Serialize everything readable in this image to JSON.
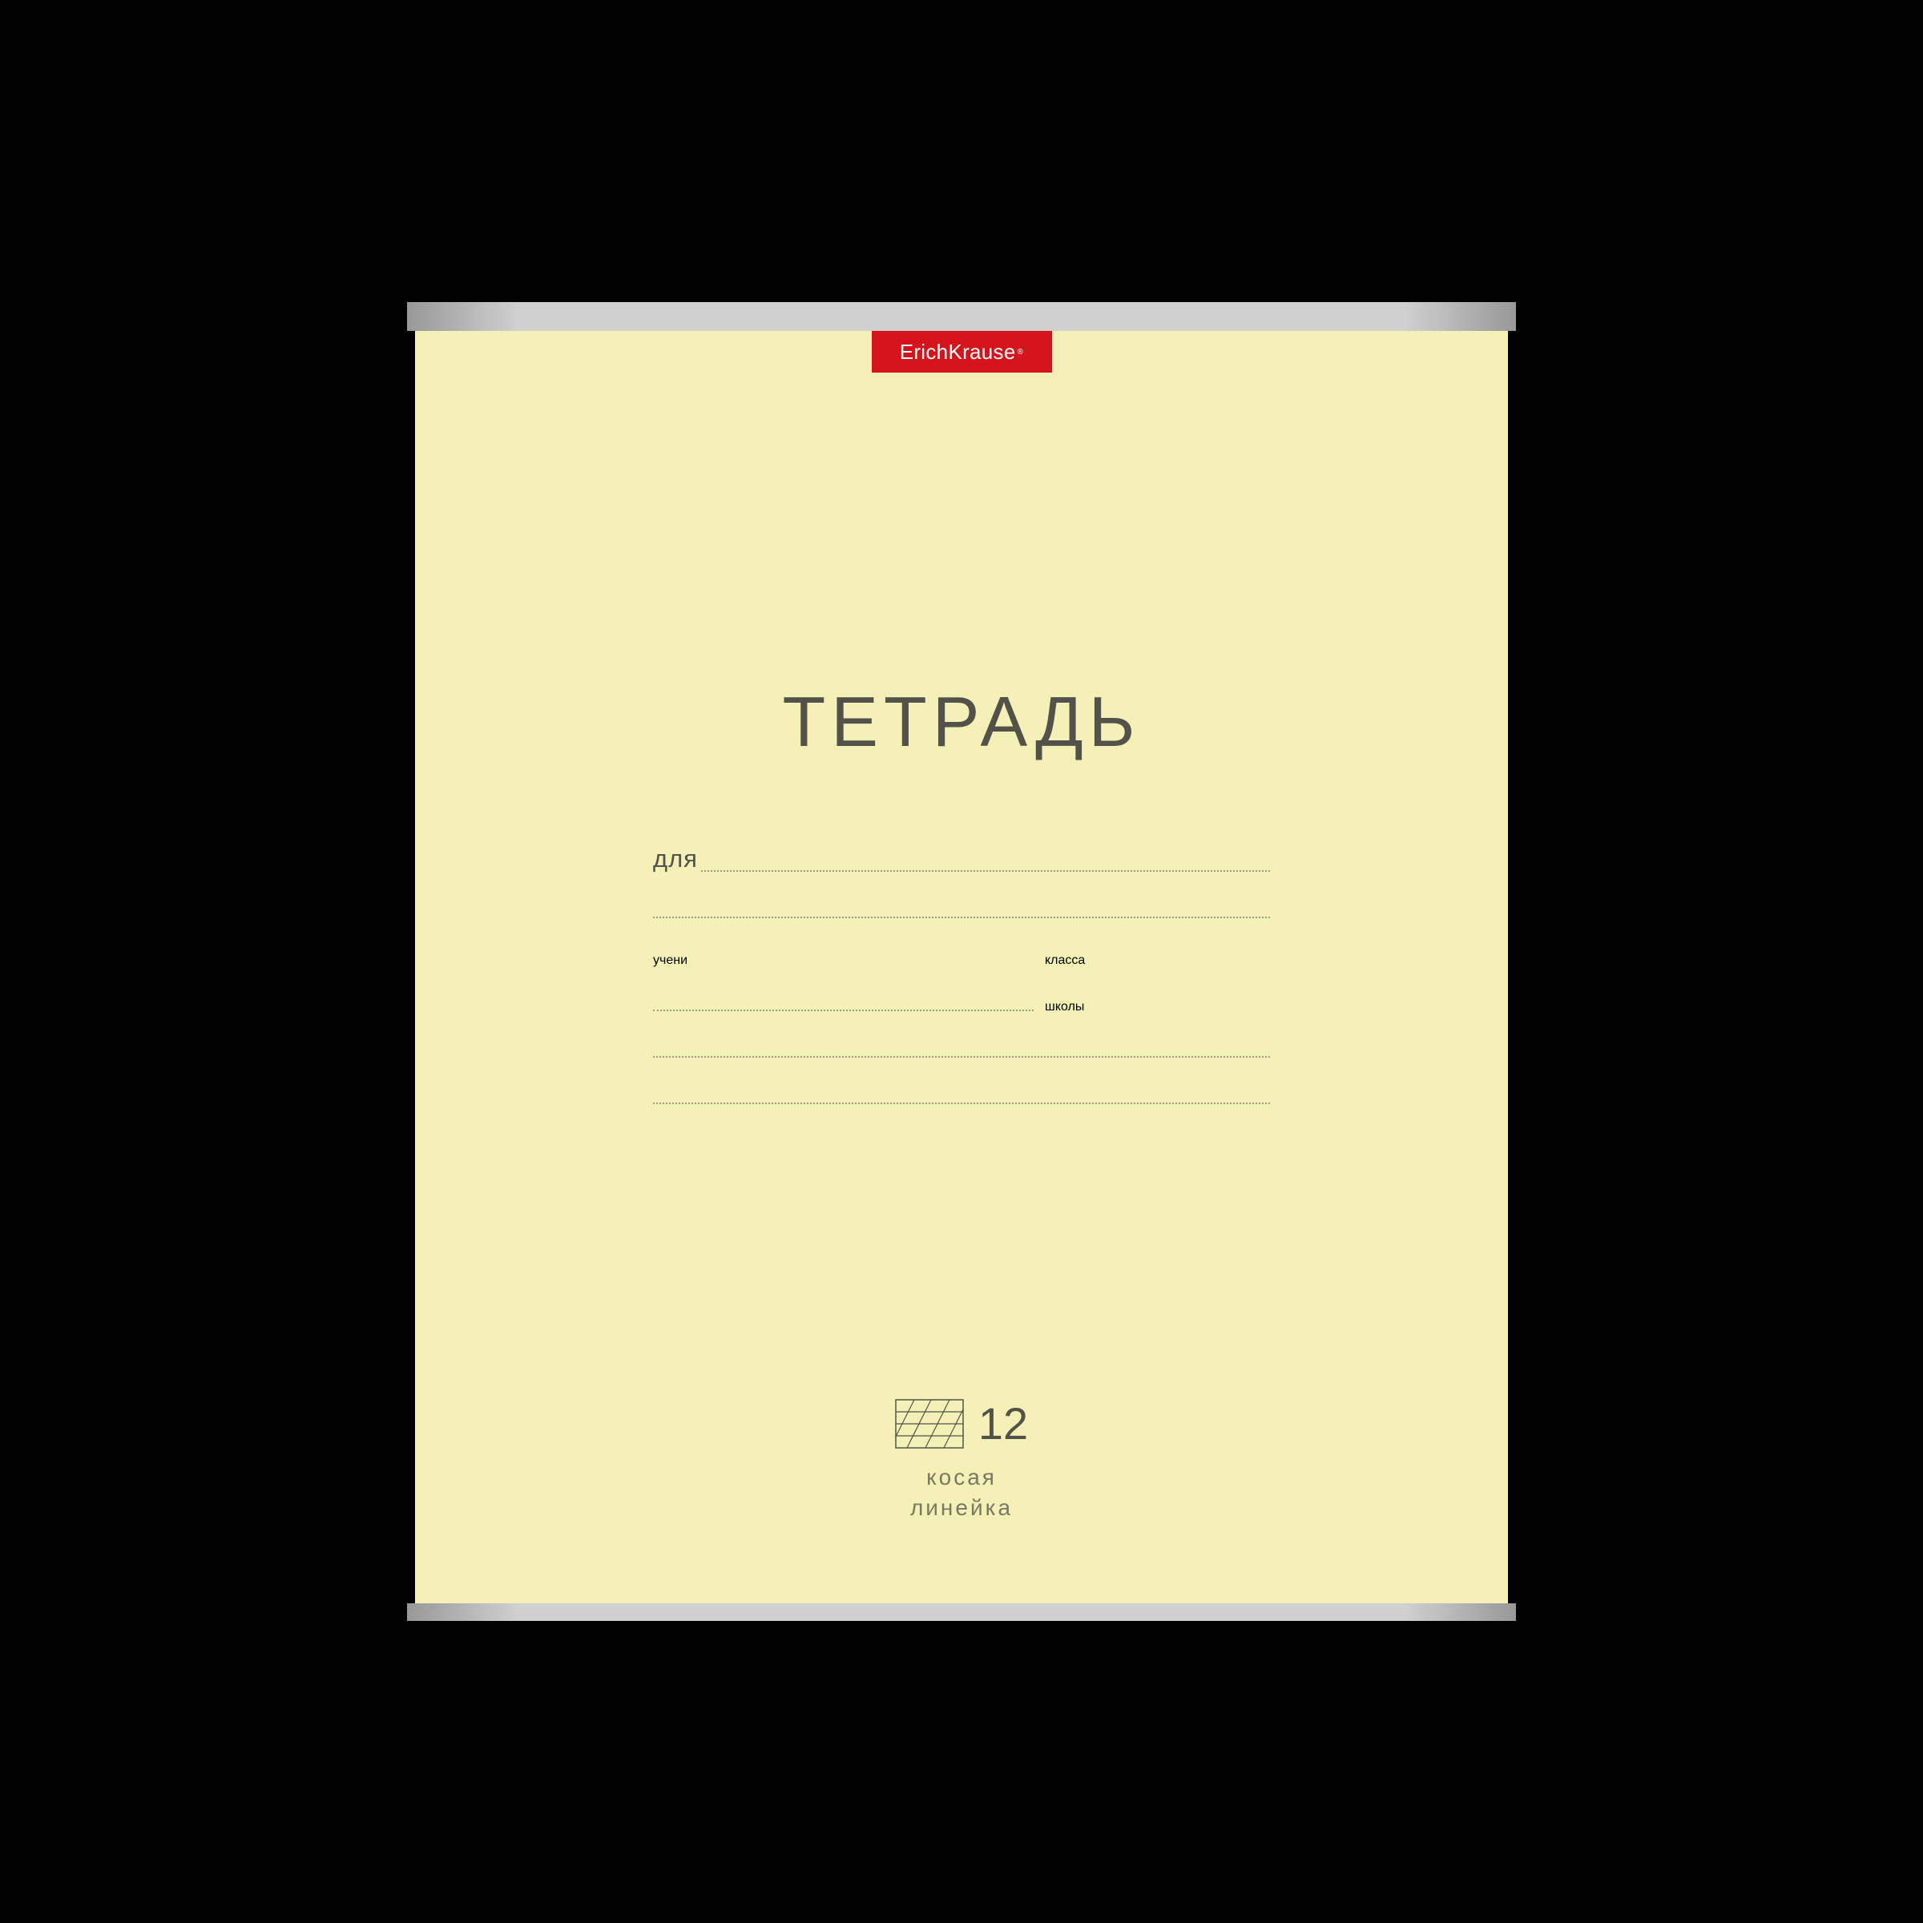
{
  "brand": {
    "name": "ErichKrause",
    "reg": "®",
    "color": "#d4131a"
  },
  "cover": {
    "title": "ТЕТРАДЬ",
    "background": "#f4f1b6"
  },
  "form": {
    "for_label": "для",
    "student_label": "учени",
    "class_label": "класса",
    "school_label": "школы"
  },
  "specs": {
    "page_count": "12",
    "ruling_line1": "косая",
    "ruling_line2": "линейка"
  }
}
